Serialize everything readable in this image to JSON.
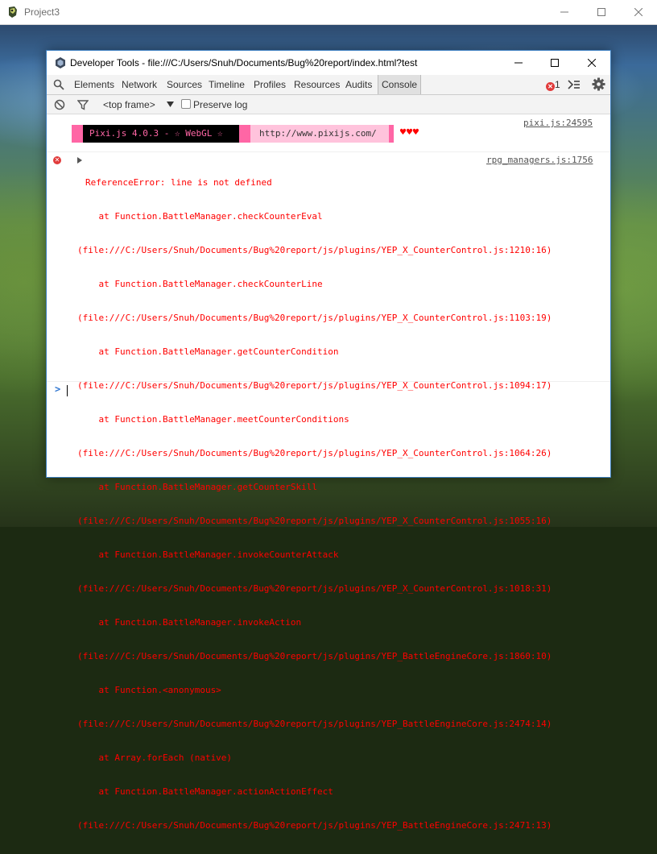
{
  "outer_window": {
    "title": "Project3",
    "icon": "rpg-maker-app-icon",
    "controls": [
      "minimize-icon",
      "maximize-icon",
      "close-icon"
    ]
  },
  "devtools_window": {
    "title": "Developer Tools - file:///C:/Users/Snuh/Documents/Bug%20report/index.html?test",
    "icon": "chrome-devtools-icon",
    "controls": [
      "minimize-icon",
      "maximize-icon",
      "close-icon"
    ]
  },
  "tabs": {
    "items": [
      {
        "label": "Elements"
      },
      {
        "label": "Network"
      },
      {
        "label": "Sources"
      },
      {
        "label": "Timeline"
      },
      {
        "label": "Profiles"
      },
      {
        "label": "Resources"
      },
      {
        "label": "Audits"
      },
      {
        "label": "Console"
      }
    ],
    "active": "Console",
    "error_count": "1"
  },
  "console_toolbar": {
    "frame_selector": "<top frame>",
    "preserve_log_label": "Preserve log",
    "preserve_log_checked": false
  },
  "console": {
    "pixi_banner": {
      "version_text": "Pixi.js 4.0.3 - ☆ WebGL ☆",
      "url_text": "http://www.pixijs.com/",
      "hearts": "♥♥♥",
      "source": "pixi.js:24595"
    },
    "error": {
      "source": "rpg_managers.js:1756",
      "lines": [
        "ReferenceError: line is not defined",
        "    at Function.BattleManager.checkCounterEval",
        "(file:///C:/Users/Snuh/Documents/Bug%20report/js/plugins/YEP_X_CounterControl.js:1210:16)",
        "    at Function.BattleManager.checkCounterLine",
        "(file:///C:/Users/Snuh/Documents/Bug%20report/js/plugins/YEP_X_CounterControl.js:1103:19)",
        "    at Function.BattleManager.getCounterCondition",
        "(file:///C:/Users/Snuh/Documents/Bug%20report/js/plugins/YEP_X_CounterControl.js:1094:17)",
        "    at Function.BattleManager.meetCounterConditions",
        "(file:///C:/Users/Snuh/Documents/Bug%20report/js/plugins/YEP_X_CounterControl.js:1064:26)",
        "    at Function.BattleManager.getCounterSkill",
        "(file:///C:/Users/Snuh/Documents/Bug%20report/js/plugins/YEP_X_CounterControl.js:1055:16)",
        "    at Function.BattleManager.invokeCounterAttack",
        "(file:///C:/Users/Snuh/Documents/Bug%20report/js/plugins/YEP_X_CounterControl.js:1018:31)",
        "    at Function.BattleManager.invokeAction",
        "(file:///C:/Users/Snuh/Documents/Bug%20report/js/plugins/YEP_BattleEngineCore.js:1860:10)",
        "    at Function.<anonymous>",
        "(file:///C:/Users/Snuh/Documents/Bug%20report/js/plugins/YEP_BattleEngineCore.js:2474:14)",
        "    at Array.forEach (native)",
        "    at Function.BattleManager.actionActionEffect",
        "(file:///C:/Users/Snuh/Documents/Bug%20report/js/plugins/YEP_BattleEngineCore.js:2471:13)"
      ]
    },
    "prompt_symbol": ">"
  },
  "colors": {
    "error_text": "#ff0000",
    "pixi_pink": "#ff66a5",
    "pixi_light_pink": "#ffc3dc",
    "prompt_blue": "#2f76d1",
    "devtools_border": "#3c7fc0"
  }
}
